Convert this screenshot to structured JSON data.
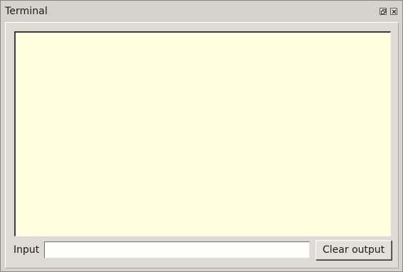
{
  "window": {
    "title": "Terminal"
  },
  "titlebar_buttons": [
    {
      "name": "float",
      "icon": "float-icon"
    },
    {
      "name": "close",
      "icon": "close-icon"
    }
  ],
  "output": {
    "text": "",
    "background": "#ffffdf"
  },
  "input": {
    "label": "Input",
    "value": "",
    "placeholder": ""
  },
  "clear_button": {
    "label": "Clear output"
  }
}
